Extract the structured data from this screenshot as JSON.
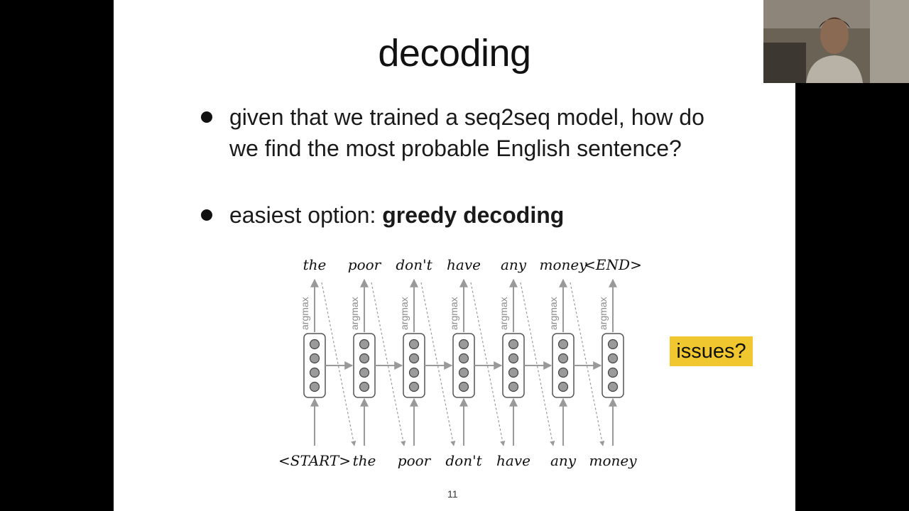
{
  "slide": {
    "title": "decoding",
    "bullets": [
      "given that we trained a seq2seq model, how do we find the most probable English sentence?",
      "easiest option: "
    ],
    "bullet2_bold": "greedy decoding",
    "issues_label": "issues?",
    "page_number": "11"
  },
  "diagram": {
    "argmax_label": "argmax",
    "output_words": [
      "the",
      "poor",
      "don't",
      "have",
      "any",
      "money",
      "<END>"
    ],
    "input_words": [
      "<START>",
      "the",
      "poor",
      "don't",
      "have",
      "any",
      "money"
    ],
    "cell_count": 7,
    "units_per_cell": 4
  },
  "colors": {
    "highlight": "#f0c72e",
    "arrow": "#999999",
    "unit_fill": "#9a9a9a"
  },
  "webcam": {
    "icon": "person-video-feed"
  }
}
